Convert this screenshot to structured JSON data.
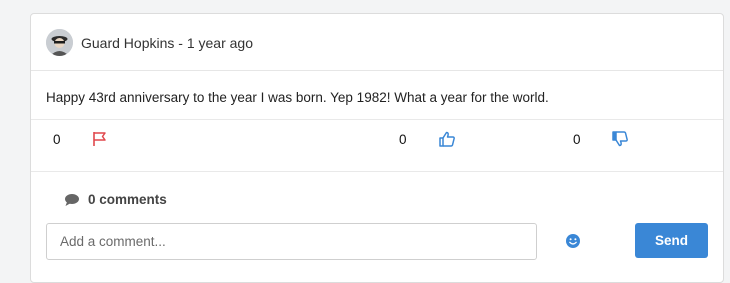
{
  "post": {
    "author": "Guard Hopkins",
    "separator": " - ",
    "time_ago": "1 year ago",
    "text": "Happy 43rd anniversary to the year I was born. Yep 1982! What a year for the world."
  },
  "actions": {
    "flag": {
      "count": "0",
      "icon": "flag-icon",
      "color": "#e0474c"
    },
    "like": {
      "count": "0",
      "icon": "thumbs-up-icon",
      "color": "#3a87d6"
    },
    "dislike": {
      "count": "0",
      "icon": "thumbs-down-icon",
      "color": "#3a87d6"
    }
  },
  "comments": {
    "count_label": "0 comments",
    "input_placeholder": "Add a comment...",
    "send_label": "Send",
    "emoji_icon": "smiley-icon"
  }
}
